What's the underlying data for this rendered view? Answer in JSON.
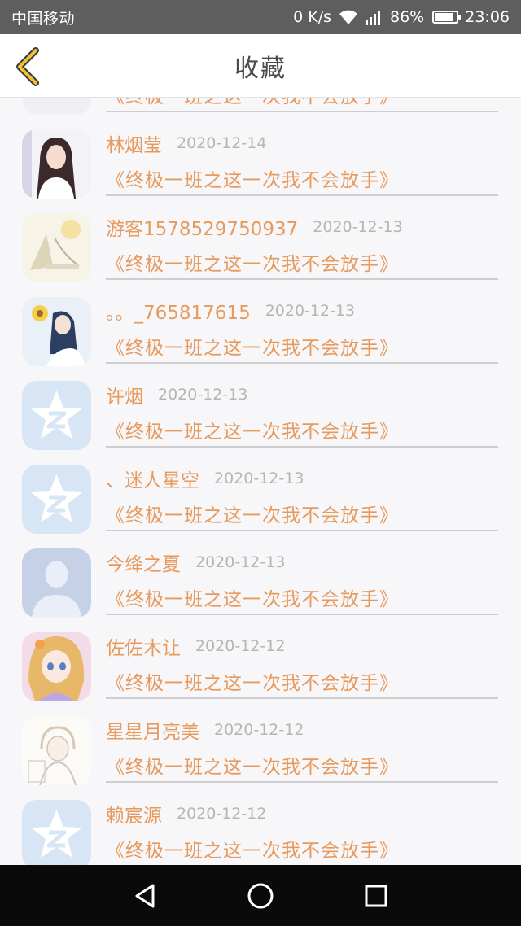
{
  "status_bar": {
    "carrier": "中国移动",
    "speed": "0 K/s",
    "battery_percent": "86%",
    "battery_level": 0.86,
    "time": "23:06"
  },
  "header": {
    "title": "收藏",
    "back_icon": "chevron-left-icon",
    "accent": "#f2c230"
  },
  "colors": {
    "name": "#e79a5d",
    "book": "#e79a5d",
    "date": "#b7b4b4"
  },
  "favorites": [
    {
      "name": "",
      "date": "",
      "book": "《终极一班之这一次我不会放手》",
      "avatar": "dark-photo"
    },
    {
      "name": "林烟莹",
      "date": "2020-12-14",
      "book": "《终极一班之这一次我不会放手》",
      "avatar": "girl-photo"
    },
    {
      "name": "游客1578529750937",
      "date": "2020-12-13",
      "book": "《终极一班之这一次我不会放手》",
      "avatar": "sketch-art"
    },
    {
      "name": "。。_765817615",
      "date": "2020-12-13",
      "book": "《终极一班之这一次我不会放手》",
      "avatar": "anime-sunflower"
    },
    {
      "name": "许烟",
      "date": "2020-12-13",
      "book": "《终极一班之这一次我不会放手》",
      "avatar": "qq-star-default"
    },
    {
      "name": "、迷人星空",
      "date": "2020-12-13",
      "book": "《终极一班之这一次我不会放手》",
      "avatar": "qq-star-default"
    },
    {
      "name": "今绛之夏",
      "date": "2020-12-13",
      "book": "《终极一班之这一次我不会放手》",
      "avatar": "person-silhouette-default"
    },
    {
      "name": "佐佐木让",
      "date": "2020-12-12",
      "book": "《终极一班之这一次我不会放手》",
      "avatar": "anime-girl-blonde"
    },
    {
      "name": "星星月亮美",
      "date": "2020-12-12",
      "book": "《终极一班之这一次我不会放手》",
      "avatar": "anime-sketch"
    },
    {
      "name": "赖宸源",
      "date": "2020-12-12",
      "book": "《终极一班之这一次我不会放手》",
      "avatar": "qq-star-default"
    }
  ],
  "nav": {
    "back": "triangle-back-icon",
    "home": "circle-home-icon",
    "recents": "square-recents-icon"
  }
}
